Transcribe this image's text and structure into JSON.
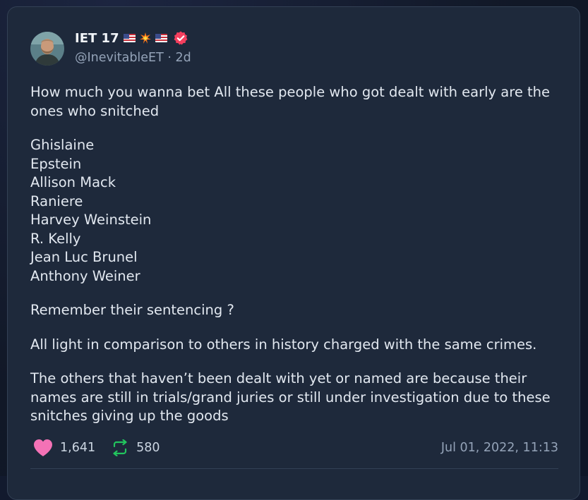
{
  "post": {
    "display_name": "IET 17",
    "handle": "@InevitableET",
    "time_ago": "2d",
    "separator": "·",
    "paragraphs": [
      "How much you wanna bet All these people who got dealt with early are the ones who snitched"
    ],
    "list": [
      "Ghislaine",
      "Epstein",
      "Allison Mack",
      "Raniere",
      "Harvey Weinstein",
      "R. Kelly",
      "Jean Luc Brunel",
      "Anthony Weiner"
    ],
    "after_list": [
      "Remember their sentencing ?",
      "All light in comparison to others in history charged with the same crimes.",
      "The others that haven’t been dealt with yet or named are because their names are still in trials/grand juries or still under investigation due to these snitches giving up the goods"
    ],
    "likes": "1,641",
    "reposts": "580",
    "date": "Jul 01, 2022, 11:13"
  },
  "icons": {
    "flag": "us-flag-icon",
    "spark": "collision-icon",
    "verified": "verified-badge-icon",
    "like": "heart-icon",
    "repost": "repost-icon"
  },
  "colors": {
    "card_bg": "#1e293b",
    "verified": "#f43f5e",
    "heart": "#f472b6",
    "repost": "#22c55e"
  }
}
